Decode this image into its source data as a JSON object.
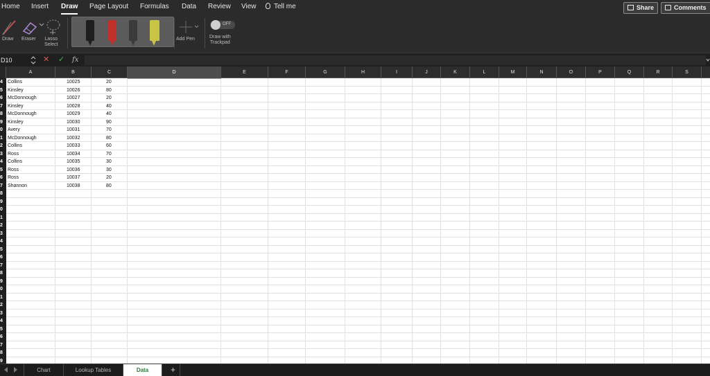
{
  "ribbon": {
    "tabs": [
      {
        "label": "Home"
      },
      {
        "label": "Insert"
      },
      {
        "label": "Draw",
        "active": true
      },
      {
        "label": "Page Layout"
      },
      {
        "label": "Formulas"
      },
      {
        "label": "Data"
      },
      {
        "label": "Review"
      },
      {
        "label": "View"
      }
    ],
    "tell_me": "Tell me",
    "share": "Share",
    "comments": "Comments"
  },
  "tools": {
    "draw": "Draw",
    "eraser": "Eraser",
    "lasso_line1": "Lasso",
    "lasso_line2": "Select",
    "add_pen": "Add Pen",
    "toggle": "OFF",
    "trackpad_line1": "Draw with",
    "trackpad_line2": "Trackpad",
    "pen_colors": [
      "#1e1e1e",
      "#c0302b",
      "#3a3a3a",
      "#c9c346"
    ]
  },
  "formula_bar": {
    "name_box": "D10",
    "fx": "fx",
    "value": ""
  },
  "sheet": {
    "columns": [
      "A",
      "B",
      "C",
      "D",
      "E",
      "F",
      "G",
      "H",
      "I",
      "J",
      "K",
      "L",
      "M",
      "N",
      "O",
      "P",
      "Q",
      "R",
      "S"
    ],
    "selected_column": "D",
    "row_labels": [
      "4",
      "5",
      "6",
      "7",
      "8",
      "9",
      "0",
      "1",
      "2",
      "3",
      "4",
      "5",
      "6",
      "7",
      "8",
      "9",
      "0",
      "1",
      "2",
      "3",
      "4",
      "5",
      "6",
      "7",
      "8",
      "9",
      "0",
      "1",
      "2",
      "3",
      "4",
      "5",
      "6",
      "7",
      "8",
      "9"
    ],
    "rows": [
      {
        "name": "Collins",
        "id": "10025",
        "value": "20"
      },
      {
        "name": "Kinsley",
        "id": "10026",
        "value": "80"
      },
      {
        "name": "McDonnough",
        "id": "10027",
        "value": "20"
      },
      {
        "name": "Kinsley",
        "id": "10028",
        "value": "40"
      },
      {
        "name": "McDonnough",
        "id": "10029",
        "value": "40"
      },
      {
        "name": "Kinsley",
        "id": "10030",
        "value": "90"
      },
      {
        "name": "Avery",
        "id": "10031",
        "value": "70"
      },
      {
        "name": "McDonnough",
        "id": "10032",
        "value": "80"
      },
      {
        "name": "Collins",
        "id": "10033",
        "value": "60"
      },
      {
        "name": "Ross",
        "id": "10034",
        "value": "70"
      },
      {
        "name": "Collins",
        "id": "10035",
        "value": "30"
      },
      {
        "name": "Ross",
        "id": "10036",
        "value": "30"
      },
      {
        "name": "Ross",
        "id": "10037",
        "value": "20"
      },
      {
        "name": "Shannon",
        "id": "10038",
        "value": "80"
      }
    ]
  },
  "sheet_tabs": [
    {
      "label": "Chart"
    },
    {
      "label": "Lookup Tables"
    },
    {
      "label": "Data",
      "active": true
    }
  ],
  "add_sheet": "+",
  "colors": {
    "chrome": "#2b2b2b",
    "active_tab_text": "#2a7a3a",
    "cancel": "#e05a5a",
    "confirm": "#4fb36a"
  }
}
